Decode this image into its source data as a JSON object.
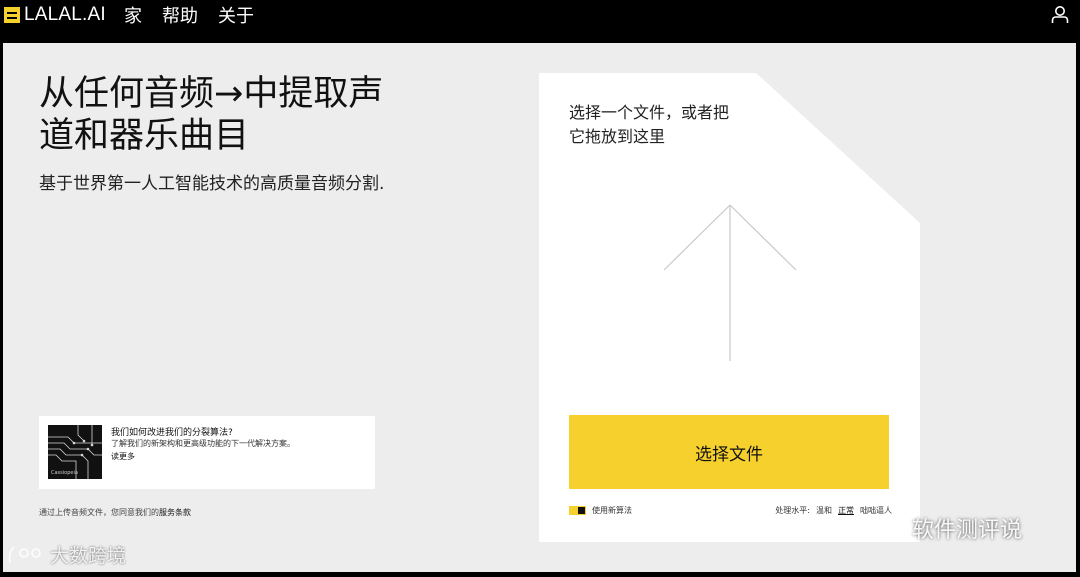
{
  "header": {
    "logo_text": "LALAL.AI",
    "nav": [
      "家",
      "帮助",
      "关于"
    ]
  },
  "hero": {
    "title": "从任何音频→中提取声道和器乐曲目",
    "subtitle": "基于世界第一人工智能技术的高质量音频分割."
  },
  "promo": {
    "image_label": "Cassiopeia",
    "title": "我们如何改进我们的分裂算法?",
    "description": "了解我们的新架构和更高级功能的下一代解决方案。",
    "read_more": "读更多"
  },
  "terms": {
    "prefix": "通过上传音频文件，您同意我们的",
    "link": "服务条款"
  },
  "upload": {
    "drop_text": "选择一个文件，或者把它拖放到这里",
    "choose_button": "选择文件",
    "algorithm_label": "使用新算法",
    "level_label": "处理水平:",
    "level_options": [
      "温和",
      "正常",
      "咄咄逼人"
    ],
    "level_selected": "正常"
  },
  "watermarks": {
    "left": "大数跨境",
    "right": "软件测评说"
  },
  "colors": {
    "accent": "#f6d12d",
    "page_bg": "#ededed",
    "topbar_bg": "#000000"
  }
}
